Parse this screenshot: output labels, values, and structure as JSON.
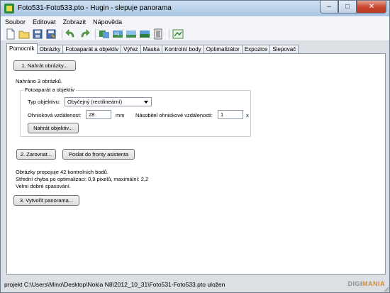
{
  "window": {
    "title": "Foto531-Foto533.pto - Hugin - slepuje panorama",
    "minimize": "–",
    "maximize": "□",
    "close": "✕"
  },
  "menu": [
    "Soubor",
    "Editovat",
    "Zobrazit",
    "Nápověda"
  ],
  "toolbar": {
    "buttons": [
      "new-file-icon",
      "open-folder-icon",
      "save-icon",
      "save-as-icon",
      "undo-icon",
      "redo-icon",
      "control-points-icon",
      "optimize-icon",
      "preview-icon",
      "fast-preview-icon",
      "layout-icon",
      "gl-preview-icon"
    ]
  },
  "tabs": [
    "Pomocník",
    "Obrázky",
    "Fotoaparát a objektiv",
    "Výřez",
    "Maska",
    "Kontrolní body",
    "Optimalizátor",
    "Expozice",
    "Slepovač"
  ],
  "assistant": {
    "load_images_button": "1. Nahrát obrázky...",
    "loaded_text": "Nahráno 3 obrázků.",
    "lens_group": "Fotoaparát a objektiv",
    "lens_type_label": "Typ objektivu:",
    "lens_type_value": "Obyčejný (rectilineární)",
    "focal_label": "Ohnisková vzdálenost:",
    "focal_value": "28",
    "focal_unit": "mm",
    "crop_label": "Násobitel ohniskové vzdálenosti:",
    "crop_value": "1",
    "crop_unit": "x",
    "load_lens_button": "Nahrát objektiv...",
    "align_button": "2. Zarovnat...",
    "queue_button": "Poslat do fronty asistenta",
    "info_line1": "Obrázky propojuje 42 kontrolních bodů.",
    "info_line2": "Střední chyba po optimalizaci: 0,9 pixelů, maximální: 2,2",
    "info_line3": "Velmi dobré spasování.",
    "create_button": "3. Vytvořit panorama..."
  },
  "status": {
    "text": "projekt C:\\Users\\Mino\\Desktop\\Nokia N8\\2012_10_31\\Foto531-Foto533.pto uložen",
    "watermark_a": "DIGI",
    "watermark_b": "MANIA"
  }
}
